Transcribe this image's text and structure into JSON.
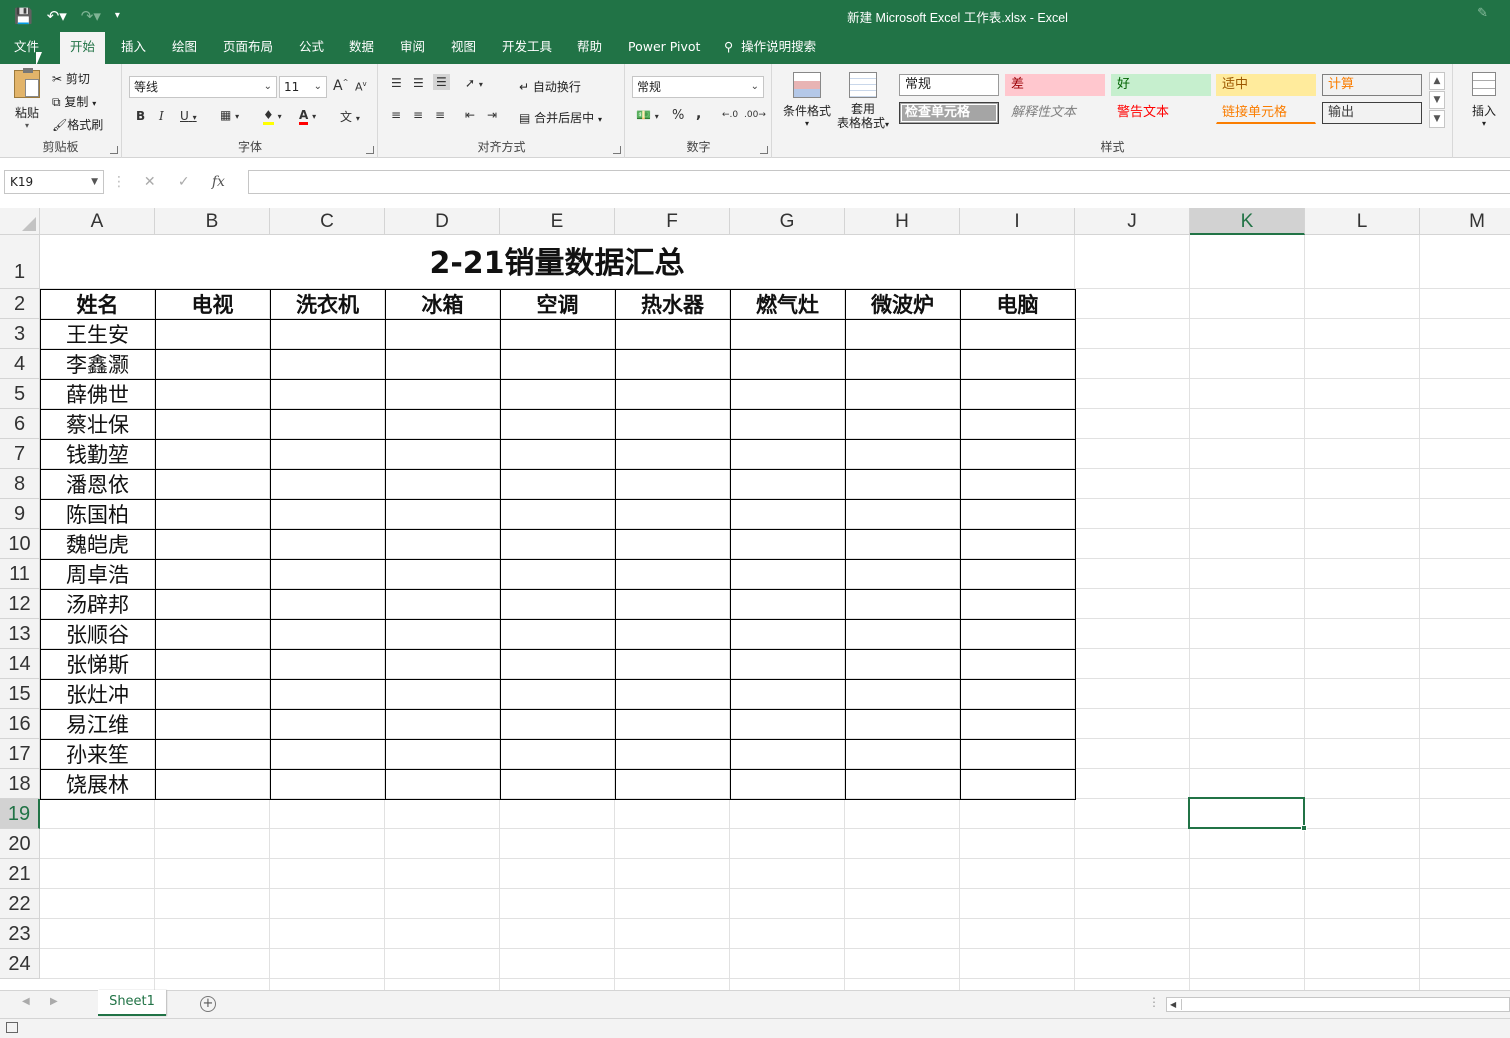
{
  "window": {
    "title": "新建 Microsoft Excel 工作表.xlsx  -  Excel",
    "qat": {
      "save_icon": "save-icon",
      "undo_icon": "undo-icon",
      "redo_icon": "redo-icon"
    }
  },
  "menu": {
    "tabs": [
      "文件",
      "开始",
      "插入",
      "绘图",
      "页面布局",
      "公式",
      "数据",
      "审阅",
      "视图",
      "开发工具",
      "帮助",
      "Power Pivot"
    ],
    "active_tab": "开始",
    "tell_me": "操作说明搜索"
  },
  "ribbon": {
    "clipboard": {
      "label": "剪贴板",
      "paste": "粘贴",
      "cut": "剪切",
      "copy": "复制",
      "format_painter": "格式刷"
    },
    "font": {
      "label": "字体",
      "font_name": "等线",
      "font_size": "11",
      "bold": "B",
      "italic": "I",
      "underline": "U",
      "grow": "A",
      "shrink": "A"
    },
    "alignment": {
      "label": "对齐方式",
      "wrap": "自动换行",
      "merge": "合并后居中"
    },
    "number": {
      "label": "数字",
      "format": "常规",
      "percent": "%",
      "comma": ","
    },
    "styles_group": {
      "label": "样式",
      "conditional": "条件格式",
      "table_format_1": "套用",
      "table_format_2": "表格格式"
    },
    "styles": [
      {
        "name": "常规",
        "bg": "#ffffff",
        "color": "#222222",
        "border": "#9a9a9a"
      },
      {
        "name": "差",
        "bg": "#ffc7ce",
        "color": "#9c0006",
        "border": "#ffc7ce"
      },
      {
        "name": "好",
        "bg": "#c6efce",
        "color": "#006100",
        "border": "#c6efce"
      },
      {
        "name": "适中",
        "bg": "#ffeb9c",
        "color": "#9c5700",
        "border": "#ffeb9c"
      },
      {
        "name": "计算",
        "bg": "#f2f2f2",
        "color": "#fa7d00",
        "border": "#7f7f7f"
      },
      {
        "name": "检查单元格",
        "bg": "#a5a5a5",
        "color": "#ffffff",
        "border": "#3f3f3f"
      },
      {
        "name": "解释性文本",
        "bg": "#f3f3f3",
        "color": "#7f7f7f",
        "border": "#f3f3f3"
      },
      {
        "name": "警告文本",
        "bg": "#f3f3f3",
        "color": "#ff0000",
        "border": "#f3f3f3"
      },
      {
        "name": "链接单元格",
        "bg": "#f3f3f3",
        "color": "#fa7d00",
        "border": "#f3f3f3"
      },
      {
        "name": "输出",
        "bg": "#f2f2f2",
        "color": "#3f3f3f",
        "border": "#3f3f3f"
      }
    ],
    "cells": {
      "insert": "插入"
    }
  },
  "formula_bar": {
    "name_box": "K19",
    "fx": "fx",
    "value": ""
  },
  "grid": {
    "columns": [
      "A",
      "B",
      "C",
      "D",
      "E",
      "F",
      "G",
      "H",
      "I",
      "J",
      "K",
      "L",
      "M"
    ],
    "rows": [
      "1",
      "2",
      "3",
      "4",
      "5",
      "6",
      "7",
      "8",
      "9",
      "10",
      "11",
      "12",
      "13",
      "14",
      "15",
      "16",
      "17",
      "18",
      "19",
      "20",
      "21",
      "22",
      "23",
      "24"
    ],
    "selected_cell": "K19",
    "title": "2-21销量数据汇总",
    "headers": [
      "姓名",
      "电视",
      "洗衣机",
      "冰箱",
      "空调",
      "热水器",
      "燃气灶",
      "微波炉",
      "电脑"
    ],
    "names": [
      "王生安",
      "李鑫灏",
      "薛佛世",
      "蔡壮保",
      "钱勤堃",
      "潘恩依",
      "陈国柏",
      "魏皑虎",
      "周卓浩",
      "汤辟邦",
      "张顺谷",
      "张悌斯",
      "张灶冲",
      "易江维",
      "孙来笙",
      "饶展林"
    ]
  },
  "sheets": {
    "tabs": [
      "Sheet1"
    ],
    "active": "Sheet1"
  },
  "colors": {
    "accent": "#217346"
  }
}
